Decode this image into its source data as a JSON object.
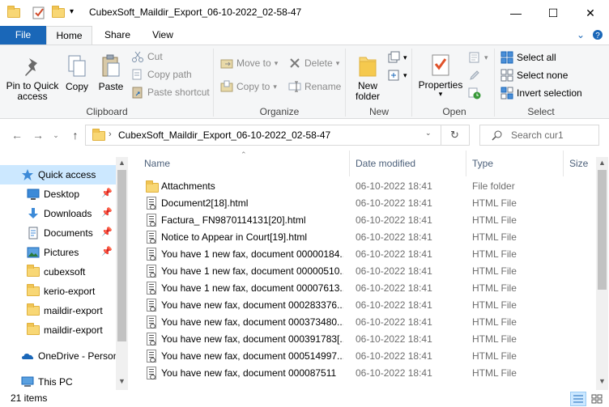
{
  "window": {
    "title": "CubexSoft_Maildir_Export_06-10-2022_02-58-47",
    "minimize_glyph": "—",
    "maximize_glyph": "☐",
    "close_glyph": "✕"
  },
  "tabs": [
    {
      "label": "File"
    },
    {
      "label": "Home"
    },
    {
      "label": "Share"
    },
    {
      "label": "View"
    }
  ],
  "ribbon": {
    "clipboard": {
      "group_label": "Clipboard",
      "pin_label": "Pin to Quick access",
      "copy_label": "Copy",
      "paste_label": "Paste",
      "cut_label": "Cut",
      "copy_path_label": "Copy path",
      "paste_shortcut_label": "Paste shortcut"
    },
    "organize": {
      "group_label": "Organize",
      "move_to_label": "Move to",
      "copy_to_label": "Copy to",
      "delete_label": "Delete",
      "rename_label": "Rename"
    },
    "new": {
      "group_label": "New",
      "new_folder_label": "New folder"
    },
    "open": {
      "group_label": "Open",
      "properties_label": "Properties"
    },
    "select": {
      "group_label": "Select",
      "select_all_label": "Select all",
      "select_none_label": "Select none",
      "invert_label": "Invert selection"
    }
  },
  "address": {
    "path": "CubexSoft_Maildir_Export_06-10-2022_02-58-47",
    "search_placeholder": "Search cur1"
  },
  "nav": {
    "items": [
      {
        "label": "Quick access",
        "icon": "star-icon",
        "pinned": false
      },
      {
        "label": "Desktop",
        "icon": "desktop-icon",
        "pinned": true
      },
      {
        "label": "Downloads",
        "icon": "download-icon",
        "pinned": true
      },
      {
        "label": "Documents",
        "icon": "documents-icon",
        "pinned": true
      },
      {
        "label": "Pictures",
        "icon": "pictures-icon",
        "pinned": true
      },
      {
        "label": "cubexsoft",
        "icon": "folder-icon",
        "pinned": false
      },
      {
        "label": "kerio-export",
        "icon": "folder-icon",
        "pinned": false
      },
      {
        "label": "maildir-export",
        "icon": "folder-icon",
        "pinned": false
      },
      {
        "label": "maildir-export",
        "icon": "folder-icon",
        "pinned": false
      },
      {
        "label": "OneDrive - Person",
        "icon": "onedrive-icon",
        "pinned": false
      },
      {
        "label": "This PC",
        "icon": "computer-icon",
        "pinned": false
      }
    ]
  },
  "filelist": {
    "columns": {
      "name": "Name",
      "date": "Date modified",
      "type": "Type",
      "size": "Size"
    },
    "rows": [
      {
        "name": "Attachments",
        "date": "06-10-2022 18:41",
        "type": "File folder",
        "icon": "folder-icon"
      },
      {
        "name": "Document2[18].html",
        "date": "06-10-2022 18:41",
        "type": "HTML File",
        "icon": "html-file-icon"
      },
      {
        "name": "Factura_ FN9870114131[20].html",
        "date": "06-10-2022 18:41",
        "type": "HTML File",
        "icon": "html-file-icon"
      },
      {
        "name": "Notice to Appear in Court[19].html",
        "date": "06-10-2022 18:41",
        "type": "HTML File",
        "icon": "html-file-icon"
      },
      {
        "name": "You have 1 new fax, document 00000184...",
        "date": "06-10-2022 18:41",
        "type": "HTML File",
        "icon": "html-file-icon"
      },
      {
        "name": "You have 1 new fax, document 00000510...",
        "date": "06-10-2022 18:41",
        "type": "HTML File",
        "icon": "html-file-icon"
      },
      {
        "name": "You have 1 new fax, document 00007613...",
        "date": "06-10-2022 18:41",
        "type": "HTML File",
        "icon": "html-file-icon"
      },
      {
        "name": "You have new fax, document 000283376...",
        "date": "06-10-2022 18:41",
        "type": "HTML File",
        "icon": "html-file-icon"
      },
      {
        "name": "You have new fax, document 000373480...",
        "date": "06-10-2022 18:41",
        "type": "HTML File",
        "icon": "html-file-icon"
      },
      {
        "name": "You have new fax, document 000391783[...",
        "date": "06-10-2022 18:41",
        "type": "HTML File",
        "icon": "html-file-icon"
      },
      {
        "name": "You have new fax, document 000514997...",
        "date": "06-10-2022 18:41",
        "type": "HTML File",
        "icon": "html-file-icon"
      },
      {
        "name": "You have new fax, document 000087511",
        "date": "06-10-2022 18:41",
        "type": "HTML File",
        "icon": "html-file-icon"
      }
    ]
  },
  "status": {
    "item_count": "21 items"
  },
  "colors": {
    "file_tab": "#1a67b8",
    "selection": "#cce8ff",
    "folder": "#f8d775"
  }
}
